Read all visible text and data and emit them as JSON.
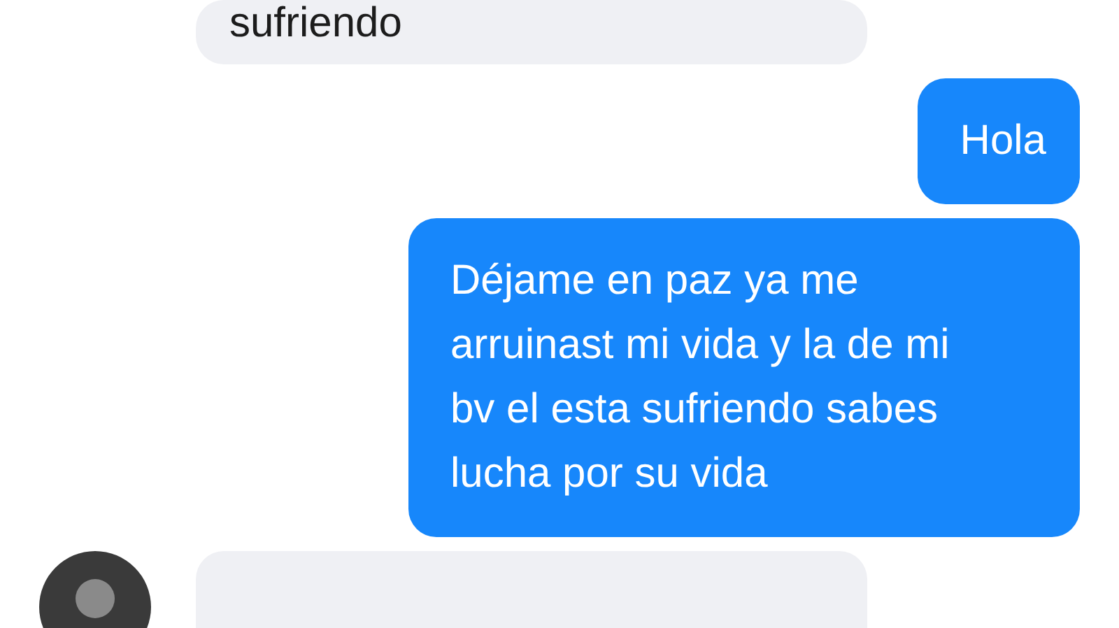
{
  "messages": [
    {
      "kind": "incoming",
      "text": "sufriendo",
      "show_avatar": false
    },
    {
      "kind": "outgoing",
      "text": "Hola"
    },
    {
      "kind": "outgoing",
      "text": "Déjame en paz ya me arruinast mi vida y la de mi bv el esta sufriendo sabes lucha por su vida"
    },
    {
      "kind": "incoming",
      "show_avatar": true
    }
  ]
}
